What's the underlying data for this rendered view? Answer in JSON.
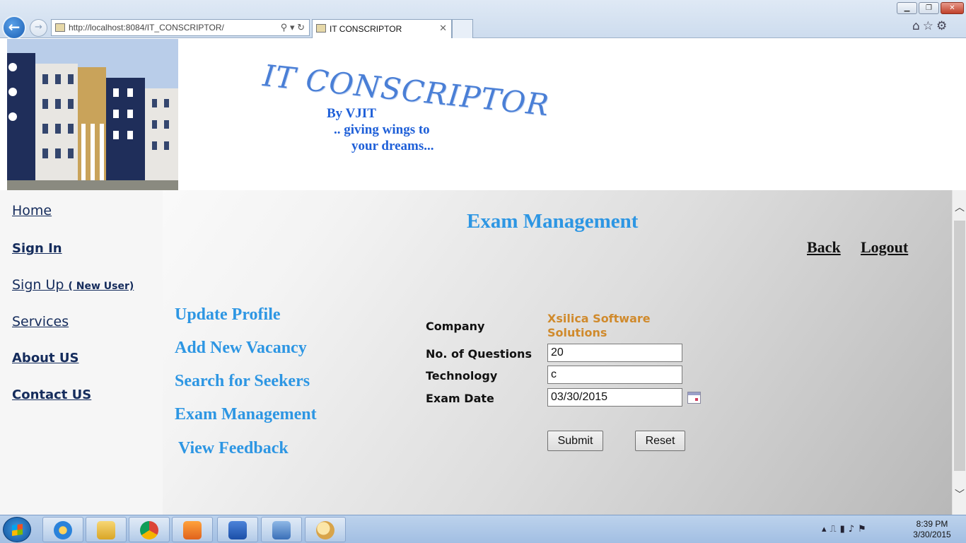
{
  "browser": {
    "url": "http://localhost:8084/IT_CONSCRIPTOR/",
    "tab_title": "IT CONSCRIPTOR",
    "window_controls": {
      "minimize": "▁",
      "maximize": "❐",
      "close": "✕"
    },
    "icons": [
      "back-arrow-icon",
      "forward-arrow-icon",
      "search-icon",
      "refresh-icon",
      "home-icon",
      "favorites-star-icon",
      "settings-gear-icon"
    ]
  },
  "header": {
    "logo_text": "IT CONSCRIPTOR",
    "tagline_1": "By VJIT",
    "tagline_2": ".. giving wings to",
    "tagline_3": "your dreams..."
  },
  "sidebar": {
    "items": [
      {
        "label": "Home"
      },
      {
        "label": "Sign In"
      },
      {
        "label": "Sign Up",
        "note": "( New User)"
      },
      {
        "label": "Services"
      },
      {
        "label": "About US"
      },
      {
        "label": "Contact US"
      }
    ]
  },
  "main": {
    "title": "Exam Management",
    "back_label": "Back",
    "logout_label": "Logout",
    "menu": [
      {
        "label": "Update Profile"
      },
      {
        "label": "Add New Vacancy"
      },
      {
        "label": "Search for Seekers"
      },
      {
        "label": "Exam Management"
      },
      {
        "label": "View Feedback"
      }
    ],
    "form": {
      "company_label": "Company",
      "company_value": "Xsilica Software Solutions",
      "questions_label": "No. of Questions",
      "questions_value": "20",
      "technology_label": "Technology",
      "technology_value": "c",
      "date_label": "Exam Date",
      "date_value": "03/30/2015",
      "submit_label": "Submit",
      "reset_label": "Reset"
    }
  },
  "taskbar": {
    "time": "8:39 PM",
    "date": "3/30/2015"
  },
  "colors": {
    "accent_blue": "#2d96e3",
    "company_orange": "#d08a2c",
    "tagline_blue": "#1e5fd8",
    "sidebar_link": "#152c5c"
  }
}
